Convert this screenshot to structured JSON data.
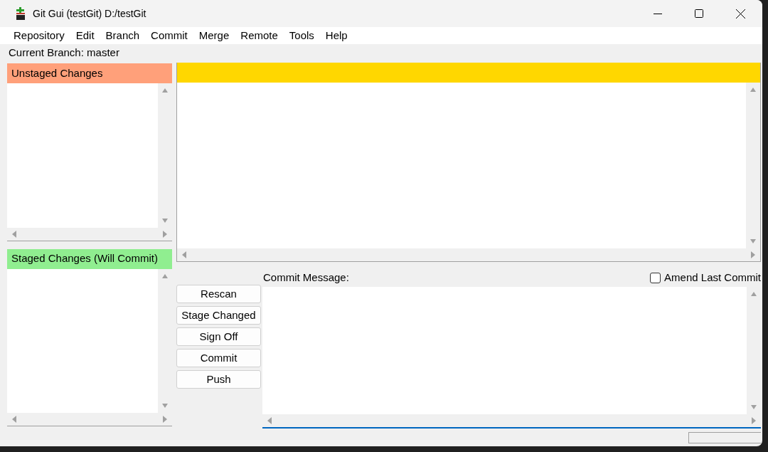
{
  "window": {
    "title": "Git Gui (testGit) D:/testGit"
  },
  "menu": [
    "Repository",
    "Edit",
    "Branch",
    "Commit",
    "Merge",
    "Remote",
    "Tools",
    "Help"
  ],
  "current_branch": "Current Branch: master",
  "unstaged": {
    "title": "Unstaged Changes"
  },
  "staged": {
    "title": "Staged Changes (Will Commit)"
  },
  "commit": {
    "label": "Commit Message:",
    "amend": {
      "label": "Amend Last Commit",
      "checked": false
    }
  },
  "buttons": [
    "Rescan",
    "Stage Changed",
    "Sign Off",
    "Commit",
    "Push"
  ]
}
